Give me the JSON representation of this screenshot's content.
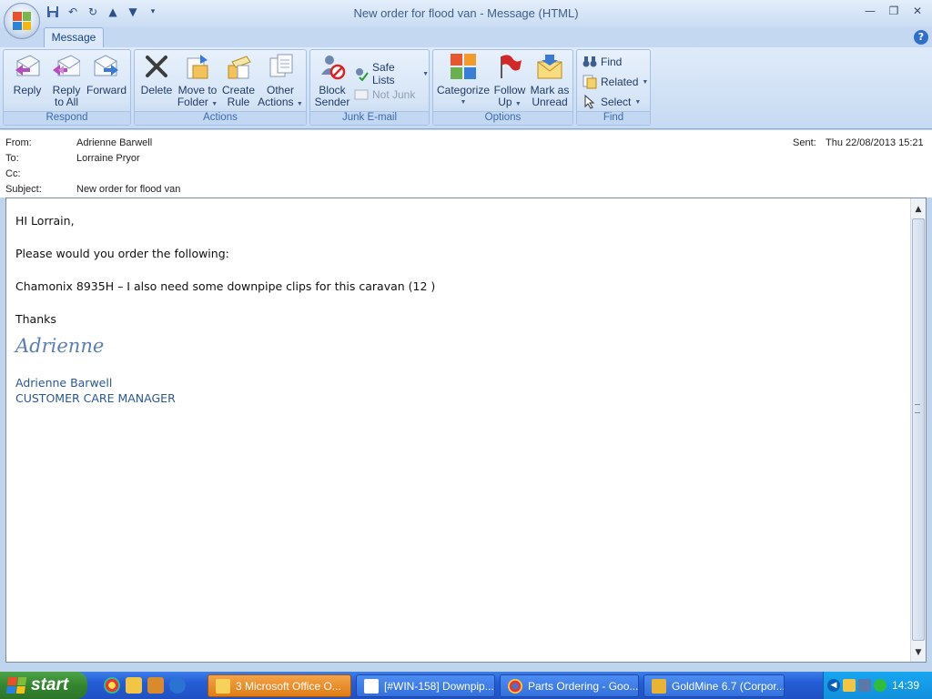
{
  "window": {
    "title": "New order for flood van - Message (HTML)",
    "controls": [
      "minimize",
      "restore",
      "close"
    ]
  },
  "tabs": [
    {
      "label": "Message",
      "active": true
    }
  ],
  "ribbon": {
    "respond": {
      "label": "Respond",
      "reply": "Reply",
      "reply_all_1": "Reply",
      "reply_all_2": "to All",
      "forward": "Forward"
    },
    "actions": {
      "label": "Actions",
      "delete": "Delete",
      "move_1": "Move to",
      "move_2": "Folder",
      "rule_1": "Create",
      "rule_2": "Rule",
      "other_1": "Other",
      "other_2": "Actions"
    },
    "junk": {
      "label": "Junk E-mail",
      "block_1": "Block",
      "block_2": "Sender",
      "safe_lists": "Safe Lists",
      "not_junk": "Not Junk"
    },
    "options": {
      "label": "Options",
      "categorize": "Categorize",
      "follow_1": "Follow",
      "follow_2": "Up",
      "mark_1": "Mark as",
      "mark_2": "Unread"
    },
    "find": {
      "label": "Find",
      "find": "Find",
      "related": "Related",
      "select": "Select"
    }
  },
  "header": {
    "from_label": "From:",
    "from": "Adrienne Barwell",
    "to_label": "To:",
    "to": "Lorraine Pryor",
    "cc_label": "Cc:",
    "cc": "",
    "subject_label": "Subject:",
    "subject": "New order for flood van",
    "sent_label": "Sent:",
    "sent": "Thu 22/08/2013 15:21"
  },
  "body": {
    "greeting": "HI Lorrain,",
    "line1": "Please would you order the following:",
    "line2": "Chamonix 8935H – I also need some downpipe clips for this caravan (12 )",
    "thanks": "Thanks",
    "signature_script": "Adrienne",
    "signature_name": "Adrienne Barwell",
    "signature_title": "CUSTOMER CARE MANAGER"
  },
  "taskbar": {
    "start": "start",
    "tasks": [
      "3 Microsoft Office O...",
      "[#WIN-158] Downpip...",
      "Parts Ordering - Goo...",
      "GoldMine 6.7 (Corpor..."
    ],
    "clock": "14:39"
  }
}
